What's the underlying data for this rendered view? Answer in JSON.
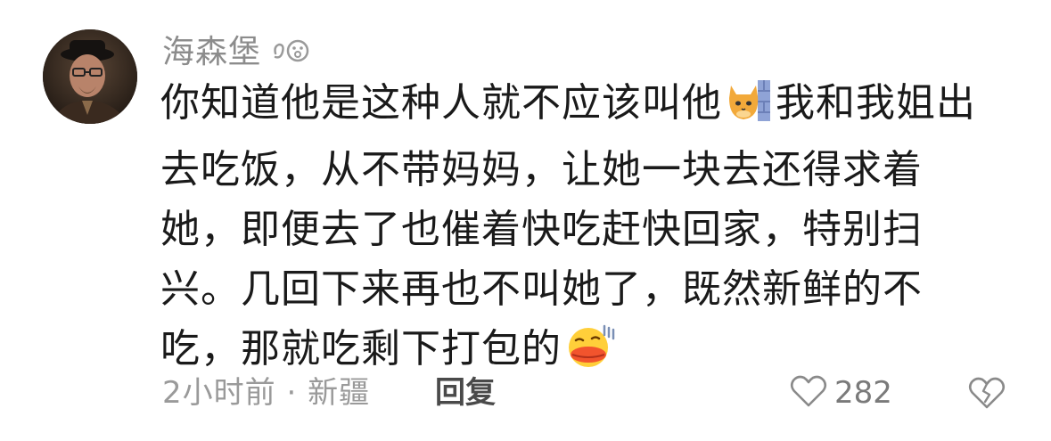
{
  "comment": {
    "username": "海森堡",
    "text_before_emoji": "你知道他是这种人就不应该叫他",
    "text_middle": "我和我姐出去吃饭，从不带妈妈，让她一块去还得求着她，即便去了也催着快吃赶快回家，特别扫兴。几回下来再也不叫她了，既然新鲜的不吃，那就吃剩下打包的",
    "emoji_1": "cat-peeking-emoji",
    "emoji_2": "duck-mouth-sweat-emoji",
    "time": "2小时前",
    "separator": "·",
    "location": "新疆",
    "reply_label": "回复",
    "like_count": "282"
  },
  "colors": {
    "username": "#8c8c8c",
    "text": "#1a1a1a",
    "meta": "#9a9a9a",
    "reply": "#4a4a4a",
    "like": "#7a7a7a"
  },
  "icons": {
    "user_badge": "user-badge-icon",
    "like": "heart-outline-icon",
    "dislike": "broken-heart-icon"
  }
}
